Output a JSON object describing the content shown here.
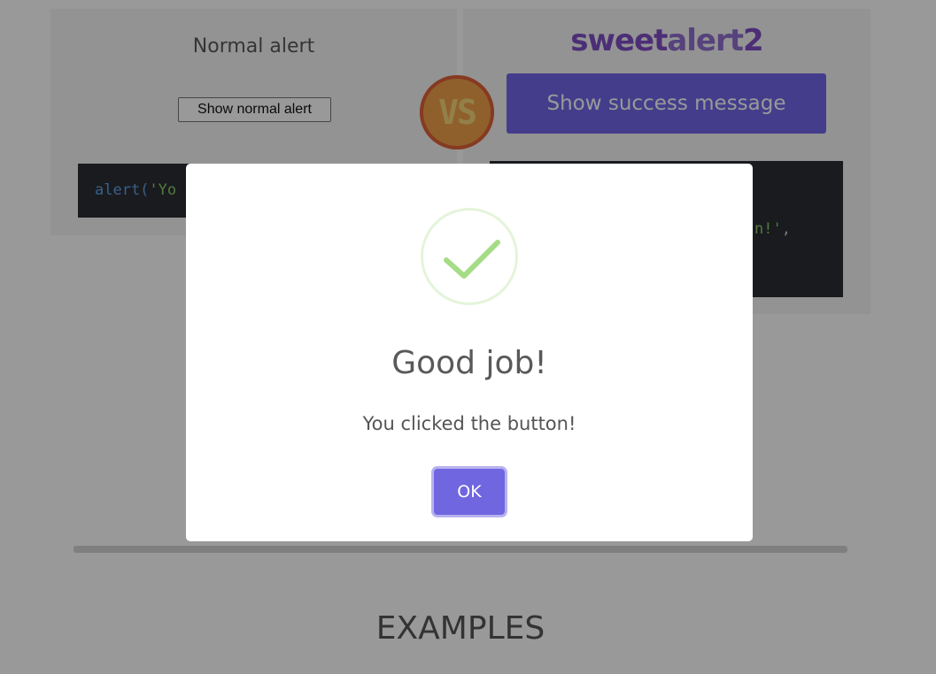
{
  "left_panel": {
    "title": "Normal alert",
    "button_label": "Show normal alert",
    "code_fn": "alert(",
    "code_str": "'Yo"
  },
  "right_panel": {
    "brand_part1": "sweet",
    "brand_part2": "alert",
    "brand_part3": "2",
    "button_label": "Show success message",
    "code_str": "n!'",
    "code_punc": ","
  },
  "vs_badge": {
    "label": "VS"
  },
  "section": {
    "heading": "EXAMPLES"
  },
  "modal": {
    "icon": "success-check-icon",
    "title": "Good job!",
    "text": "You clicked the button!",
    "confirm_label": "OK"
  },
  "colors": {
    "accent": "#7066e0",
    "success_green": "#a5dc86",
    "overlay": "rgba(0,0,0,0.4)"
  }
}
